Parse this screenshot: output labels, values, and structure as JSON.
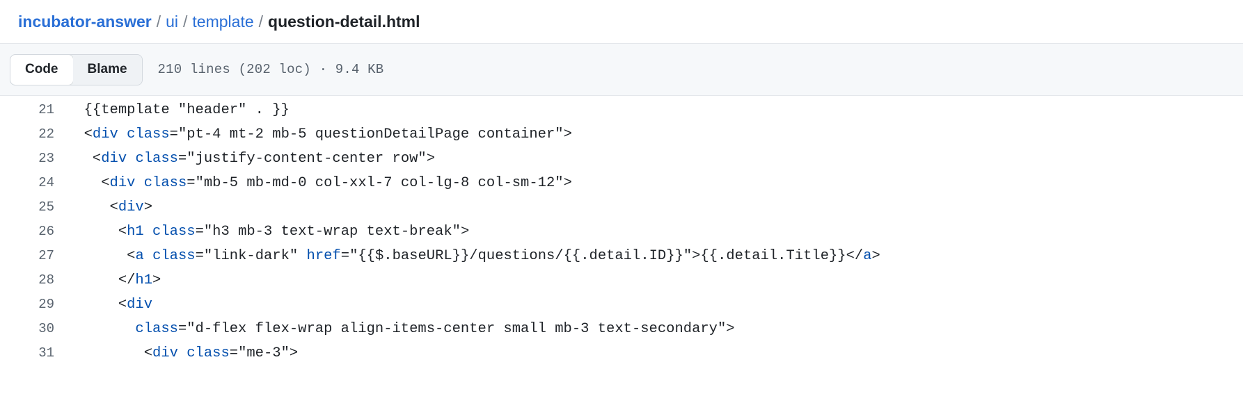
{
  "breadcrumb": {
    "repo": "incubator-answer",
    "sep": "/",
    "parts": [
      "ui",
      "template"
    ],
    "current": "question-detail.html"
  },
  "toolbar": {
    "code_label": "Code",
    "blame_label": "Blame",
    "file_meta": "210 lines (202 loc) · 9.4 KB"
  },
  "code": {
    "lines": [
      {
        "number": "21",
        "indent": "  ",
        "tokens": [
          {
            "t": "txt",
            "v": "{{template \"header\" . }}"
          }
        ]
      },
      {
        "number": "22",
        "indent": "  ",
        "tokens": [
          {
            "t": "pun",
            "v": "<"
          },
          {
            "t": "tag",
            "v": "div"
          },
          {
            "t": "txt",
            "v": " "
          },
          {
            "t": "attr",
            "v": "class"
          },
          {
            "t": "pun",
            "v": "="
          },
          {
            "t": "str",
            "v": "\"pt-4 mt-2 mb-5 questionDetailPage container\""
          },
          {
            "t": "pun",
            "v": ">"
          }
        ]
      },
      {
        "number": "23",
        "indent": "   ",
        "tokens": [
          {
            "t": "pun",
            "v": "<"
          },
          {
            "t": "tag",
            "v": "div"
          },
          {
            "t": "txt",
            "v": " "
          },
          {
            "t": "attr",
            "v": "class"
          },
          {
            "t": "pun",
            "v": "="
          },
          {
            "t": "str",
            "v": "\"justify-content-center row\""
          },
          {
            "t": "pun",
            "v": ">"
          }
        ]
      },
      {
        "number": "24",
        "indent": "    ",
        "tokens": [
          {
            "t": "pun",
            "v": "<"
          },
          {
            "t": "tag",
            "v": "div"
          },
          {
            "t": "txt",
            "v": " "
          },
          {
            "t": "attr",
            "v": "class"
          },
          {
            "t": "pun",
            "v": "="
          },
          {
            "t": "str",
            "v": "\"mb-5 mb-md-0 col-xxl-7 col-lg-8 col-sm-12\""
          },
          {
            "t": "pun",
            "v": ">"
          }
        ]
      },
      {
        "number": "25",
        "indent": "     ",
        "tokens": [
          {
            "t": "pun",
            "v": "<"
          },
          {
            "t": "tag",
            "v": "div"
          },
          {
            "t": "pun",
            "v": ">"
          }
        ]
      },
      {
        "number": "26",
        "indent": "      ",
        "tokens": [
          {
            "t": "pun",
            "v": "<"
          },
          {
            "t": "tag",
            "v": "h1"
          },
          {
            "t": "txt",
            "v": " "
          },
          {
            "t": "attr",
            "v": "class"
          },
          {
            "t": "pun",
            "v": "="
          },
          {
            "t": "str",
            "v": "\"h3 mb-3 text-wrap text-break\""
          },
          {
            "t": "pun",
            "v": ">"
          }
        ]
      },
      {
        "number": "27",
        "indent": "       ",
        "tokens": [
          {
            "t": "pun",
            "v": "<"
          },
          {
            "t": "tag",
            "v": "a"
          },
          {
            "t": "txt",
            "v": " "
          },
          {
            "t": "attr",
            "v": "class"
          },
          {
            "t": "pun",
            "v": "="
          },
          {
            "t": "str",
            "v": "\"link-dark\""
          },
          {
            "t": "txt",
            "v": " "
          },
          {
            "t": "attr",
            "v": "href"
          },
          {
            "t": "pun",
            "v": "="
          },
          {
            "t": "str",
            "v": "\"{{$.baseURL}}/questions/{{.detail.ID}}\""
          },
          {
            "t": "pun",
            "v": ">"
          },
          {
            "t": "txt",
            "v": "{{.detail.Title}}"
          },
          {
            "t": "pun",
            "v": "</"
          },
          {
            "t": "tag",
            "v": "a"
          },
          {
            "t": "pun",
            "v": ">"
          }
        ]
      },
      {
        "number": "28",
        "indent": "      ",
        "tokens": [
          {
            "t": "pun",
            "v": "</"
          },
          {
            "t": "tag",
            "v": "h1"
          },
          {
            "t": "pun",
            "v": ">"
          }
        ]
      },
      {
        "number": "29",
        "indent": "      ",
        "tokens": [
          {
            "t": "pun",
            "v": "<"
          },
          {
            "t": "tag",
            "v": "div"
          }
        ]
      },
      {
        "number": "30",
        "indent": "        ",
        "tokens": [
          {
            "t": "attr",
            "v": "class"
          },
          {
            "t": "pun",
            "v": "="
          },
          {
            "t": "str",
            "v": "\"d-flex flex-wrap align-items-center small mb-3 text-secondary\""
          },
          {
            "t": "pun",
            "v": ">"
          }
        ]
      },
      {
        "number": "31",
        "indent": "         ",
        "tokens": [
          {
            "t": "pun",
            "v": "<"
          },
          {
            "t": "tag",
            "v": "div"
          },
          {
            "t": "txt",
            "v": " "
          },
          {
            "t": "attr",
            "v": "class"
          },
          {
            "t": "pun",
            "v": "="
          },
          {
            "t": "str",
            "v": "\"me-3\""
          },
          {
            "t": "pun",
            "v": ">"
          }
        ]
      }
    ]
  },
  "colors": {
    "link": "#2a6fd6",
    "syntax_tag": "#0550ae",
    "text": "#1f2328",
    "muted": "#59636e",
    "toolbar_bg": "#f6f8fa",
    "border": "#e4e7eb"
  }
}
